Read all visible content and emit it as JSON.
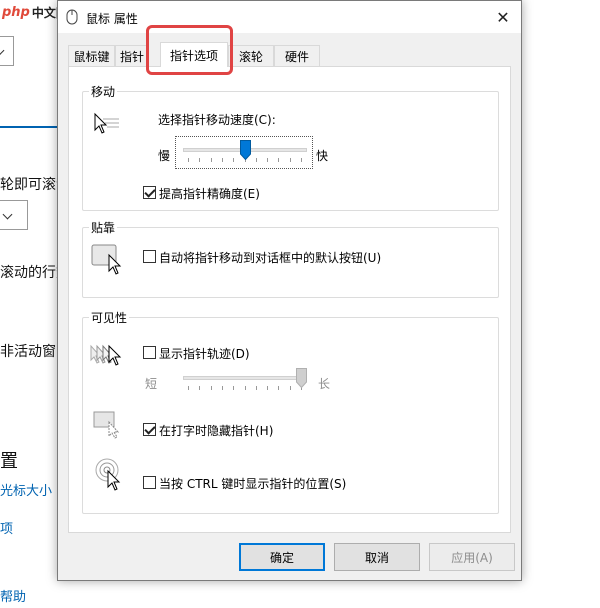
{
  "background": {
    "logo_php": "php",
    "logo_cn": "中文网",
    "line1": "轮即可滚动",
    "line2": "滚动的行数",
    "line3": "非活动窗口",
    "line4": "置",
    "line5": "光标大小",
    "line6": "项",
    "line7": "帮助"
  },
  "dialog": {
    "title": "鼠标 属性",
    "close_glyph": "✕",
    "tabs": [
      "鼠标键",
      "指针",
      "指针选项",
      "滚轮",
      "硬件"
    ],
    "active_tab": "指针选项",
    "motion": {
      "group_label": "移动",
      "speed_label": "选择指针移动速度(C):",
      "slow": "慢",
      "fast": "快",
      "speed_value": 0.5,
      "precision_label": "提高指针精确度(E)",
      "precision_checked": true
    },
    "snap": {
      "group_label": "贴靠",
      "snap_label": "自动将指针移动到对话框中的默认按钮(U)",
      "snap_checked": false
    },
    "visibility": {
      "group_label": "可见性",
      "trails_label": "显示指针轨迹(D)",
      "trails_checked": false,
      "short": "短",
      "long": "长",
      "trail_value": 1.0,
      "hide_label": "在打字时隐藏指针(H)",
      "hide_checked": true,
      "ctrl_label": "当按 CTRL 键时显示指针的位置(S)",
      "ctrl_checked": false
    },
    "buttons": {
      "ok": "确定",
      "cancel": "取消",
      "apply": "应用(A)"
    },
    "colors": {
      "accent": "#0078d7",
      "highlight": "#e04444"
    }
  }
}
